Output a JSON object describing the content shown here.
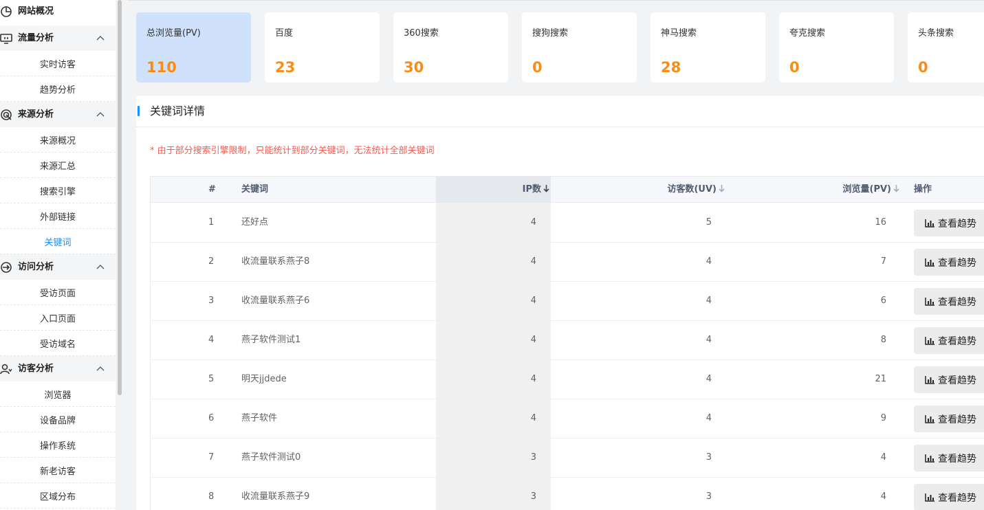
{
  "sidebar": {
    "overview": "网站概况",
    "groups": [
      {
        "label": "流量分析",
        "items": [
          "实时访客",
          "趋势分析"
        ]
      },
      {
        "label": "来源分析",
        "items": [
          "来源概况",
          "来源汇总",
          "搜索引擎",
          "外部链接",
          "关键词"
        ]
      },
      {
        "label": "访问分析",
        "items": [
          "受访页面",
          "入口页面",
          "受访域名"
        ]
      },
      {
        "label": "访客分析",
        "items": [
          "浏览器",
          "设备品牌",
          "操作系统",
          "新老访客",
          "区域分布"
        ]
      }
    ],
    "active_item": "关键词"
  },
  "cards": [
    {
      "label": "总浏览量(PV)",
      "value": "110"
    },
    {
      "label": "百度",
      "value": "23"
    },
    {
      "label": "360搜索",
      "value": "30"
    },
    {
      "label": "搜狗搜索",
      "value": "0"
    },
    {
      "label": "神马搜索",
      "value": "28"
    },
    {
      "label": "夸克搜索",
      "value": "0"
    },
    {
      "label": "头条搜索",
      "value": "0"
    }
  ],
  "panel": {
    "title": "关键词详情",
    "notice": "* 由于部分搜索引擎限制，只能统计到部分关键词，无法统计全部关键词"
  },
  "table": {
    "headers": {
      "index": "#",
      "keyword": "关键词",
      "ip": "IP数",
      "uv": "访客数(UV)",
      "pv": "浏览量(PV)",
      "action": "操作"
    },
    "action_label": "查看趋势",
    "rows": [
      {
        "index": "1",
        "keyword": "还好点",
        "ip": "4",
        "uv": "5",
        "pv": "16"
      },
      {
        "index": "2",
        "keyword": "收流量联系燕子8",
        "ip": "4",
        "uv": "4",
        "pv": "7"
      },
      {
        "index": "3",
        "keyword": "收流量联系燕子6",
        "ip": "4",
        "uv": "4",
        "pv": "6"
      },
      {
        "index": "4",
        "keyword": "燕子软件测试1",
        "ip": "4",
        "uv": "4",
        "pv": "8"
      },
      {
        "index": "5",
        "keyword": "明天jjdede",
        "ip": "4",
        "uv": "4",
        "pv": "21"
      },
      {
        "index": "6",
        "keyword": "燕子软件",
        "ip": "4",
        "uv": "4",
        "pv": "9"
      },
      {
        "index": "7",
        "keyword": "燕子软件测试0",
        "ip": "3",
        "uv": "3",
        "pv": "4"
      },
      {
        "index": "8",
        "keyword": "收流量联系燕子9",
        "ip": "3",
        "uv": "3",
        "pv": "4"
      }
    ]
  },
  "colors": {
    "accent": "#1890ff",
    "value": "#fa8c16",
    "notice": "#f5594e",
    "active_card": "#cfe1fb"
  }
}
